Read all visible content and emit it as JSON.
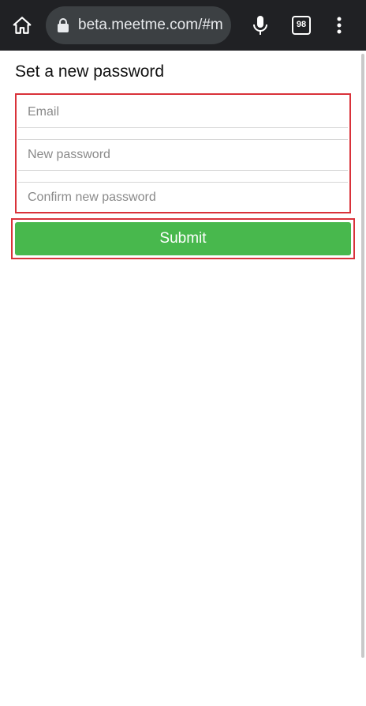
{
  "browser": {
    "url": "beta.meetme.com/#m",
    "tab_count": "98"
  },
  "page": {
    "title": "Set a new password",
    "fields": {
      "email_placeholder": "Email",
      "new_password_placeholder": "New password",
      "confirm_password_placeholder": "Confirm new password"
    },
    "submit_label": "Submit"
  },
  "colors": {
    "toolbar_bg": "#202124",
    "url_pill_bg": "#3c4043",
    "submit_bg": "#48b84d",
    "highlight_border": "#d9323a"
  },
  "icons": {
    "home": "home-icon",
    "lock": "lock-icon",
    "mic": "microphone-icon",
    "menu": "more-vert-icon"
  }
}
